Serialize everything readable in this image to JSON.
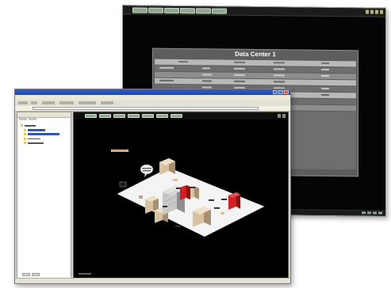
{
  "back_window": {
    "panel_title": "Data Center 1",
    "toolbar_buttons": 7,
    "row_count": 12
  },
  "front_window": {
    "tree_nodes": 5,
    "viewport_buttons": 7
  },
  "colors": {
    "viewport_bg": "#000000",
    "floor": "#f4f4f4",
    "rack_tan": "#d8c3a0",
    "rack_red": "#d22020",
    "button_green": "#8fa98c",
    "titlebar_blue": "#1b46b3"
  }
}
